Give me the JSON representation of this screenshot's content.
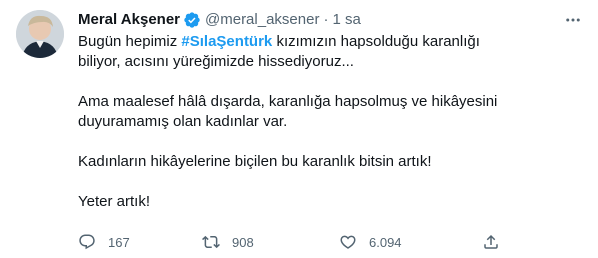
{
  "author": {
    "name": "Meral Akşener",
    "handle": "@meral_aksener",
    "separator": "·",
    "time": "1 sa"
  },
  "tweet": {
    "line1_pre": "Bugün hepimiz ",
    "hashtag": "#SılaŞentürk",
    "line1_post": " kızımızın hapsolduğu karanlığı biliyor, acısını yüreğimizde hissediyoruz...",
    "paragraph2": "Ama maalesef hâlâ dışarda, karanlığa hapsolmuş ve hikâyesini duyuramamış olan kadınlar var.",
    "paragraph3": "Kadınların hikâyelerine biçilen bu karanlık bitsin artık!",
    "paragraph4": "Yeter artık!"
  },
  "actions": {
    "replies": "167",
    "retweets": "908",
    "likes": "6.094"
  },
  "colors": {
    "link": "#1d9bf0",
    "muted": "#536471",
    "text": "#0f1419",
    "verified": "#1d9bf0"
  },
  "icons": [
    "verified-badge-icon",
    "more-options-icon",
    "reply-icon",
    "retweet-icon",
    "like-icon",
    "share-icon"
  ]
}
